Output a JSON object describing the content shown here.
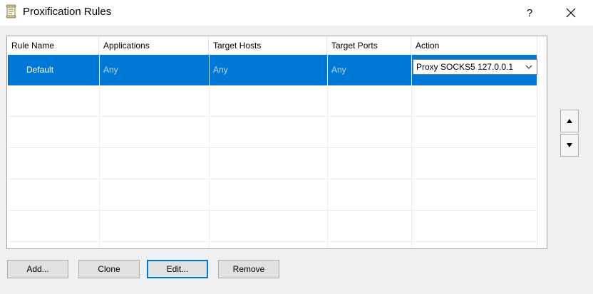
{
  "window": {
    "title": "Proxification Rules",
    "help_label": "?",
    "icons": {
      "app": "scroll-document-icon",
      "close": "close-x-icon"
    }
  },
  "table": {
    "columns": [
      "Rule Name",
      "Applications",
      "Target Hosts",
      "Target Ports",
      "Action"
    ],
    "rows": [
      {
        "rule_name": "Default",
        "applications": "Any",
        "target_hosts": "Any",
        "target_ports": "Any",
        "action": "Proxy SOCKS5 127.0.0.1",
        "selected": true
      }
    ],
    "selection_color": "#0078d7"
  },
  "side_buttons": {
    "up_icon": "arrow-up-icon",
    "down_icon": "arrow-down-icon"
  },
  "buttons": {
    "add": "Add...",
    "clone": "Clone",
    "edit": "Edit...",
    "remove": "Remove"
  }
}
